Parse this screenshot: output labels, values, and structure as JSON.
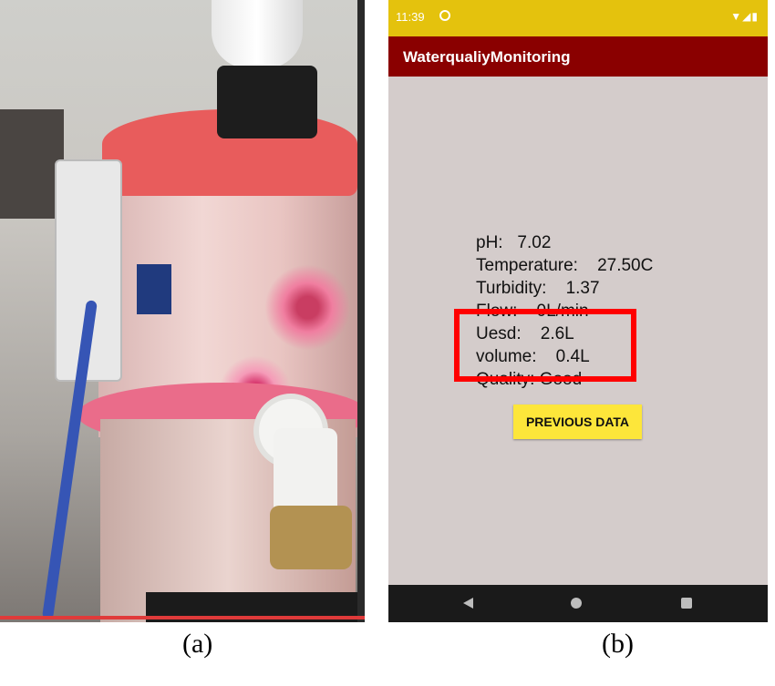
{
  "captions": {
    "a": "(a)",
    "b": "(b)"
  },
  "status_bar": {
    "time": "11:39",
    "right_icons": "▼◢▮"
  },
  "app_bar": {
    "title": "WaterqualiyMonitoring"
  },
  "readings": [
    {
      "label": "pH:",
      "value": "7.02"
    },
    {
      "label": "Temperature:",
      "value": "27.50C"
    },
    {
      "label": "Turbidity:",
      "value": "1.37"
    },
    {
      "label": "Flow:",
      "value": "0L/min"
    },
    {
      "label": "Uesd:",
      "value": "2.6L"
    },
    {
      "label": "volume:",
      "value": "0.4L"
    },
    {
      "label": "Quality:",
      "value": "Good"
    }
  ],
  "previous_data_button": "PREVIOUS DATA",
  "colors": {
    "status_bar": "#e4c20d",
    "app_bar": "#8a0000",
    "screen_bg": "#d4cccb",
    "button": "#fde63a",
    "highlight_box": "#ff0000",
    "nav_bar": "#1a1a1a"
  },
  "nav_icons": [
    "back-icon",
    "home-icon",
    "recents-icon"
  ]
}
